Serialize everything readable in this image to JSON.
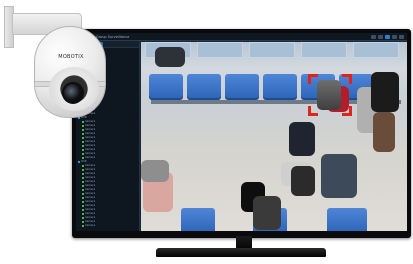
{
  "camera": {
    "brand": "MOBOTIX",
    "icon": "ptz-dome-camera-icon"
  },
  "app": {
    "title": "Group Surveillance",
    "accent": "#2b7fd0",
    "roi_color": "#e2231a"
  },
  "sidebar": {
    "items": [
      {
        "label": "DVR",
        "type": "group"
      },
      {
        "label": "Camera",
        "type": "cam"
      },
      {
        "label": "Camera",
        "type": "cam"
      },
      {
        "label": "Camera",
        "type": "cam"
      },
      {
        "label": "Camera",
        "type": "cam"
      },
      {
        "label": "Camera",
        "type": "cam"
      },
      {
        "label": "Camera",
        "type": "cam"
      },
      {
        "label": "Camera",
        "type": "cam"
      },
      {
        "label": "Camera",
        "type": "cam"
      },
      {
        "label": "Camera",
        "type": "cam"
      },
      {
        "label": "Camera",
        "type": "cam"
      },
      {
        "label": "Camera",
        "type": "cam"
      },
      {
        "label": "Camera",
        "type": "cam"
      },
      {
        "label": "Camera",
        "type": "cam"
      },
      {
        "label": "Camera",
        "type": "cam"
      },
      {
        "label": "Camera",
        "type": "cam"
      },
      {
        "label": "Camera",
        "type": "cam"
      },
      {
        "label": "DVR",
        "type": "group"
      },
      {
        "label": "Camera",
        "type": "cam"
      },
      {
        "label": "Camera",
        "type": "cam"
      },
      {
        "label": "Camera",
        "type": "cam"
      },
      {
        "label": "Camera",
        "type": "cam"
      },
      {
        "label": "Camera",
        "type": "cam"
      },
      {
        "label": "Camera",
        "type": "cam"
      },
      {
        "label": "Camera",
        "type": "cam"
      },
      {
        "label": "Camera",
        "type": "cam"
      },
      {
        "label": "Camera",
        "type": "cam"
      },
      {
        "label": "Camera",
        "type": "cam"
      },
      {
        "label": "DVR",
        "type": "group"
      },
      {
        "label": "Camera",
        "type": "cam"
      },
      {
        "label": "Camera",
        "type": "cam"
      },
      {
        "label": "Camera",
        "type": "cam"
      },
      {
        "label": "Camera",
        "type": "cam"
      },
      {
        "label": "Camera",
        "type": "cam"
      },
      {
        "label": "Camera",
        "type": "cam"
      },
      {
        "label": "Camera",
        "type": "cam"
      },
      {
        "label": "Camera",
        "type": "cam"
      },
      {
        "label": "Camera",
        "type": "cam"
      },
      {
        "label": "Camera",
        "type": "cam"
      },
      {
        "label": "Camera",
        "type": "cam"
      },
      {
        "label": "Camera",
        "type": "cam"
      },
      {
        "label": "Camera",
        "type": "cam"
      },
      {
        "label": "Camera",
        "type": "cam"
      },
      {
        "label": "Camera",
        "type": "cam"
      },
      {
        "label": "Camera",
        "type": "cam"
      }
    ]
  }
}
